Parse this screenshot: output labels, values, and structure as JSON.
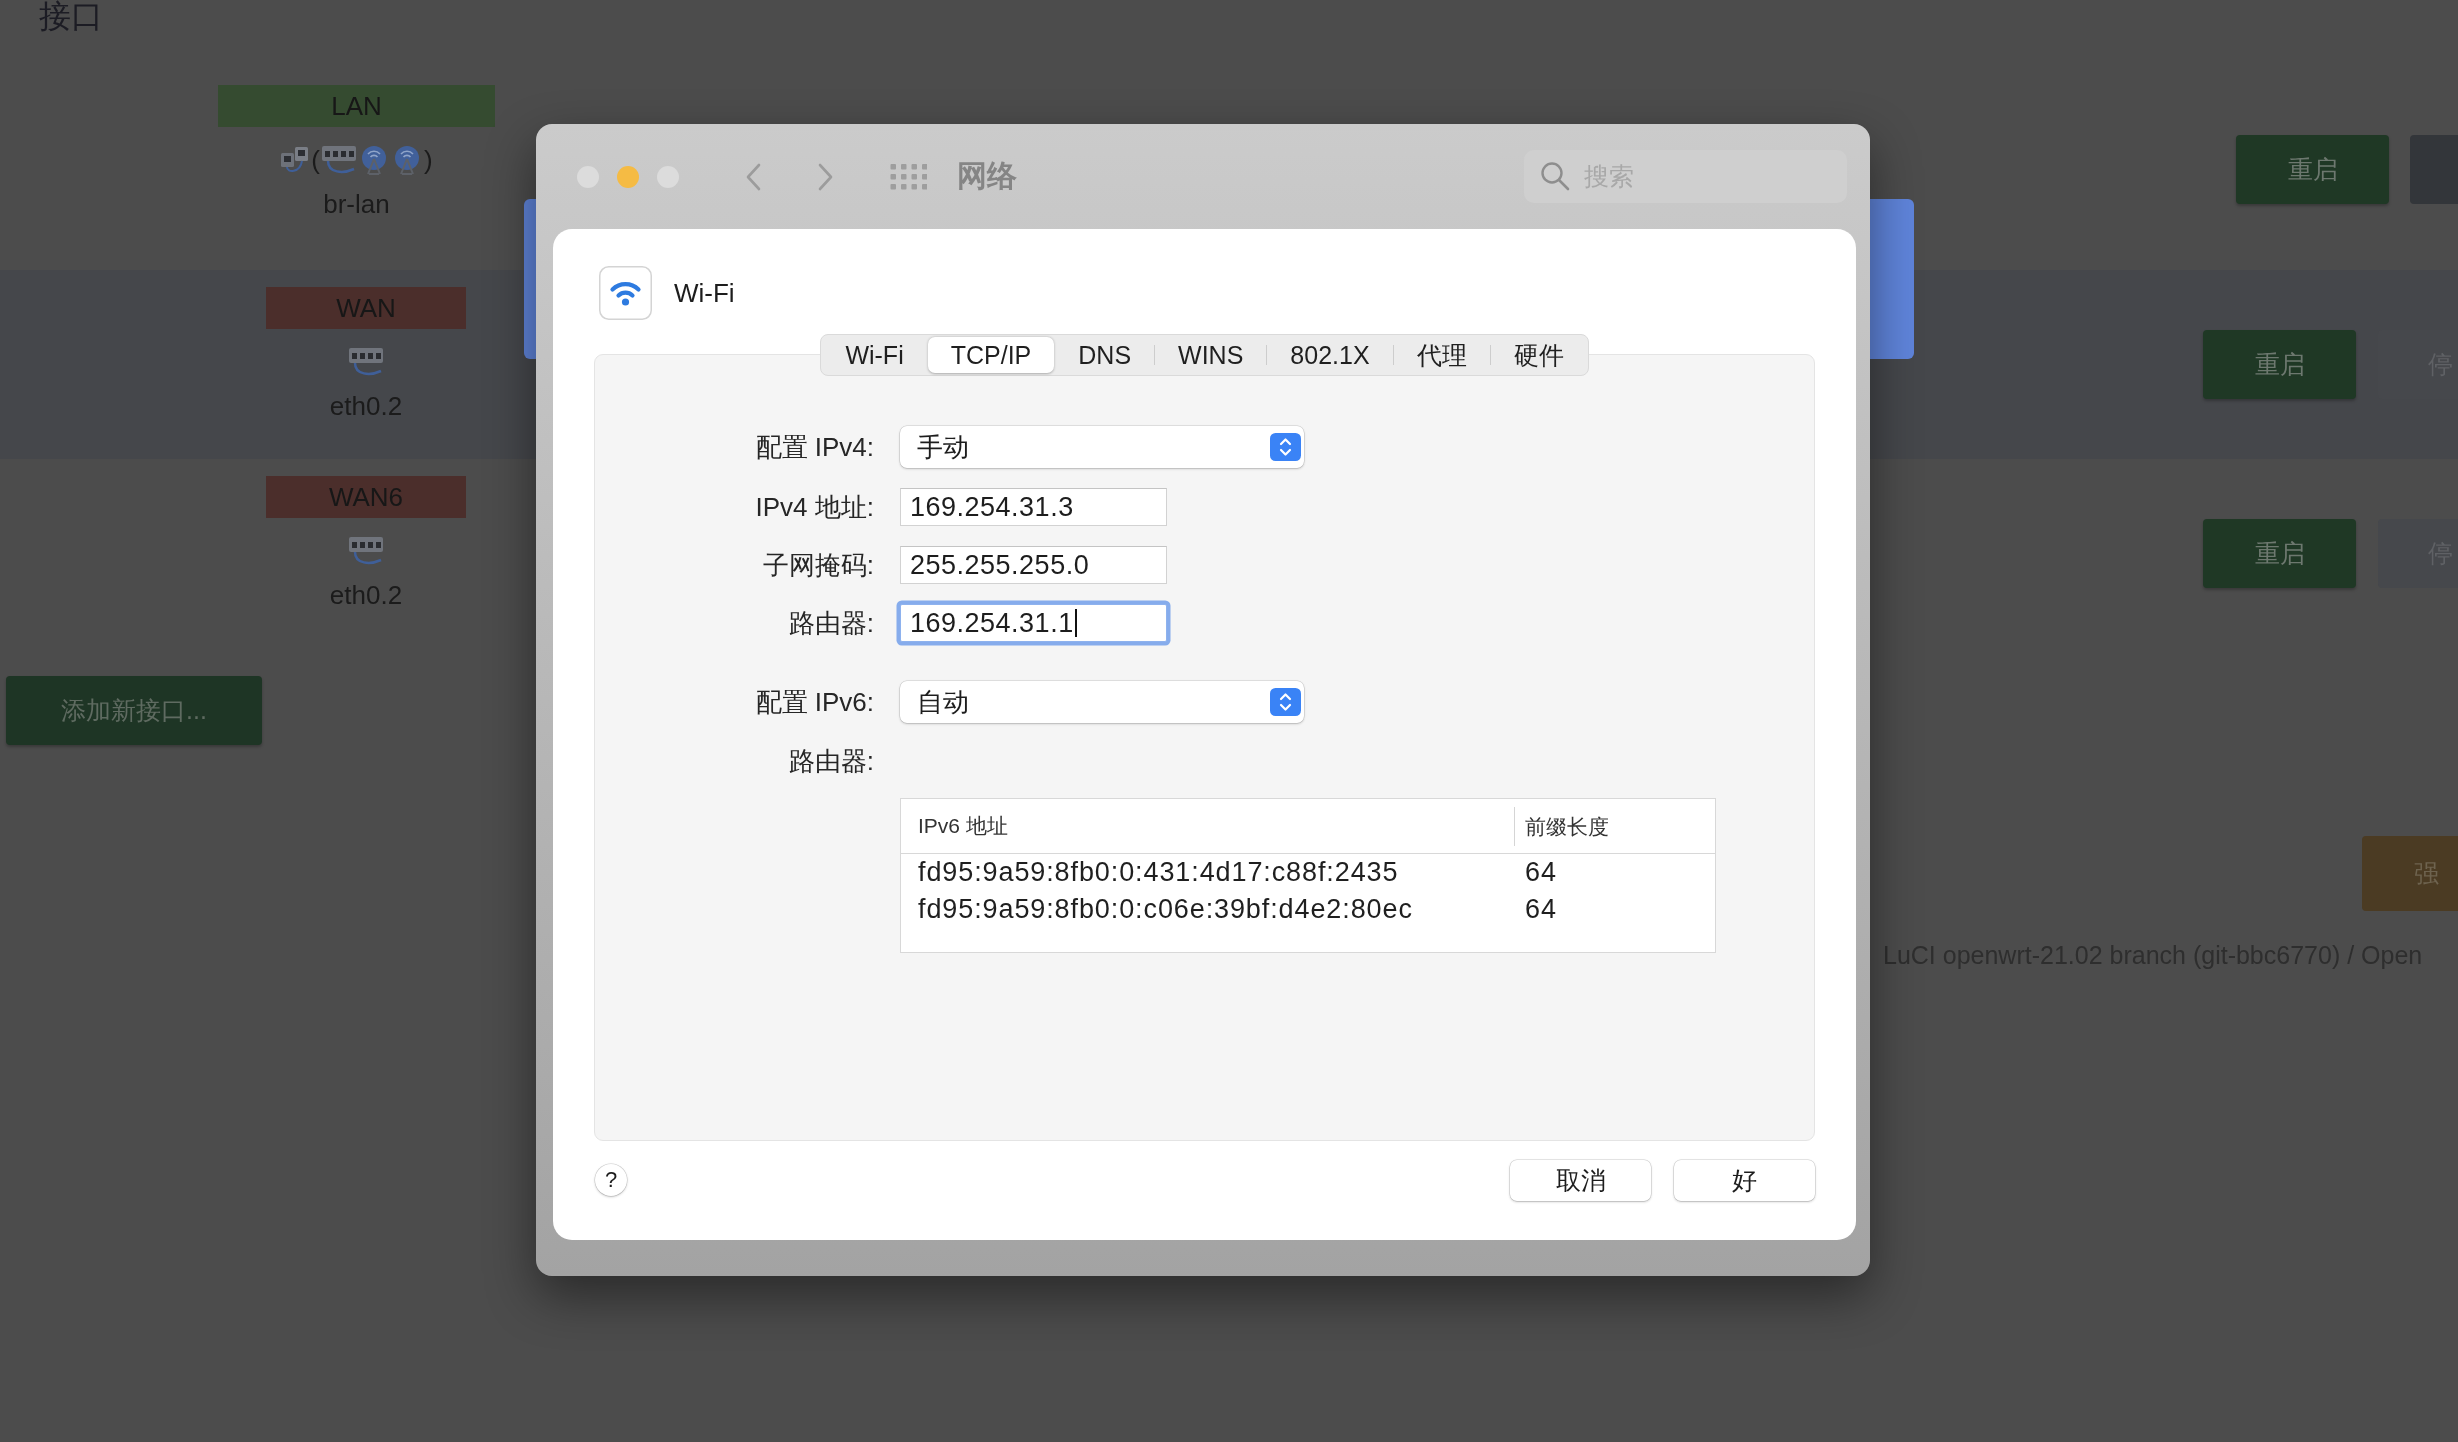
{
  "page": {
    "heading": "接口",
    "interfaces": [
      {
        "name": "LAN",
        "color": "#354b30",
        "devices": [
          {
            "kind": "bridge"
          },
          {
            "kind": "paren",
            "text": "("
          },
          {
            "kind": "switch"
          },
          {
            "kind": "wireless"
          },
          {
            "kind": "wireless"
          },
          {
            "kind": "paren",
            "text": ")"
          }
        ],
        "device_name": "br-lan",
        "actions": [
          {
            "kind": "primary",
            "label": "重启"
          },
          {
            "kind": "dark"
          }
        ]
      },
      {
        "name": "WAN",
        "color": "#4b2e2b",
        "devices": [
          {
            "kind": "switch"
          }
        ],
        "device_name": "eth0.2",
        "actions": [
          {
            "kind": "primary",
            "label": "重启"
          },
          {
            "kind": "secondary",
            "label": "停"
          }
        ]
      },
      {
        "name": "WAN6",
        "color": "#4b2e2b",
        "devices": [
          {
            "kind": "switch"
          }
        ],
        "device_name": "eth0.2",
        "actions": [
          {
            "kind": "primary",
            "label": "重启"
          },
          {
            "kind": "secondary",
            "label": "停"
          }
        ]
      }
    ],
    "add_button": "添加新接口...",
    "force_button": "强",
    "footer": "LuCI openwrt-21.02 branch (git-bbc6770) / Open"
  },
  "dialog": {
    "controls": [
      {
        "color": "#dcdcdc"
      },
      {
        "color": "#f5bb44"
      },
      {
        "color": "#dcdcdc"
      }
    ],
    "title": "网络",
    "search": {
      "placeholder": "搜索"
    },
    "service": "Wi-Fi",
    "tabs": [
      {
        "label": "Wi-Fi",
        "selected": false
      },
      {
        "label": "TCP/IP",
        "selected": true
      },
      {
        "label": "DNS",
        "selected": false
      },
      {
        "label": "WINS",
        "selected": false
      },
      {
        "label": "802.1X",
        "selected": false
      },
      {
        "label": "代理",
        "selected": false
      },
      {
        "label": "硬件",
        "selected": false
      }
    ],
    "fields": [
      {
        "kind": "popup",
        "label": "配置 IPv4:",
        "value": "手动"
      },
      {
        "kind": "text",
        "label": "IPv4 地址:",
        "value": "169.254.31.3",
        "focused": false
      },
      {
        "kind": "text",
        "label": "子网掩码:",
        "value": "255.255.255.0",
        "focused": false
      },
      {
        "kind": "text",
        "label": "路由器:",
        "value": "169.254.31.1",
        "focused": true
      },
      {
        "kind": "popup",
        "label": "配置 IPv6:",
        "value": "自动"
      },
      {
        "kind": "static",
        "label": "路由器:"
      }
    ],
    "ipv6_table": {
      "columns": [
        "IPv6 地址",
        "前缀长度"
      ],
      "rows": [
        [
          "fd95:9a59:8fb0:0:431:4d17:c88f:2435",
          "64"
        ],
        [
          "fd95:9a59:8fb0:0:c06e:39bf:d4e2:80ec",
          "64"
        ]
      ]
    },
    "help": "?",
    "buttons": [
      "取消",
      "好"
    ]
  }
}
